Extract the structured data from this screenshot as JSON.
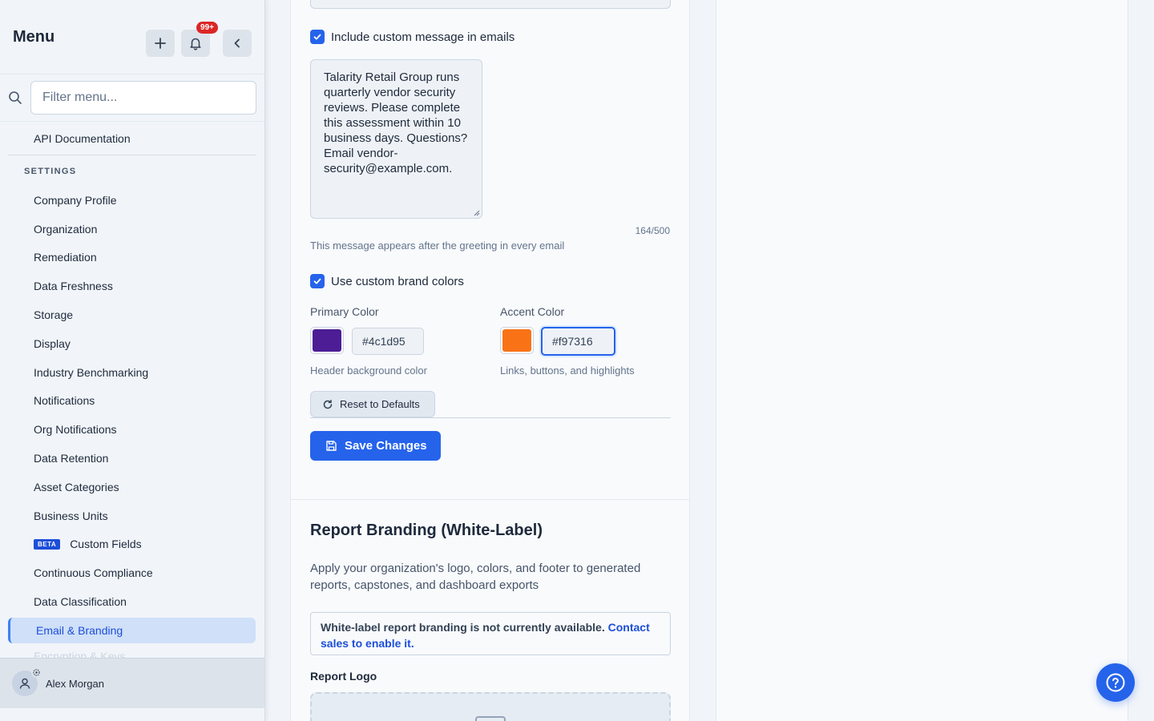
{
  "sidebar": {
    "title": "Menu",
    "notification_badge": "99+",
    "filter_placeholder": "Filter menu...",
    "api_item": "API Documentation",
    "section_label": "SETTINGS",
    "items": [
      {
        "label": "Company Profile"
      },
      {
        "label": "Organization"
      },
      {
        "label": "Remediation"
      },
      {
        "label": "Data Freshness"
      },
      {
        "label": "Storage"
      },
      {
        "label": "Display"
      },
      {
        "label": "Industry Benchmarking"
      },
      {
        "label": "Notifications"
      },
      {
        "label": "Org Notifications"
      },
      {
        "label": "Data Retention"
      },
      {
        "label": "Asset Categories"
      },
      {
        "label": "Business Units"
      },
      {
        "label": "Custom Fields",
        "tag": "BETA"
      },
      {
        "label": "Continuous Compliance"
      },
      {
        "label": "Data Classification"
      },
      {
        "label": "Email & Branding",
        "active": true
      },
      {
        "label": "Encryption & Keys"
      }
    ],
    "user_name": "Alex Morgan"
  },
  "email_settings": {
    "custom_message_label": "Include custom message in emails",
    "custom_message_checked": true,
    "custom_message_text": "Talarity Retail Group runs quarterly vendor security reviews. Please complete this assessment within 10 business days. Questions? Email vendor-security@example.com.",
    "char_counter": "164/500",
    "custom_message_help": "This message appears after the greeting in every email",
    "brand_colors_label": "Use custom brand colors",
    "brand_colors_checked": true,
    "primary_color_label": "Primary Color",
    "primary_color_value": "#4c1d95",
    "primary_color_help": "Header background color",
    "accent_color_label": "Accent Color",
    "accent_color_value": "#f97316",
    "accent_color_help": "Links, buttons, and highlights",
    "reset_label": "Reset to Defaults",
    "save_label": "Save Changes"
  },
  "report_branding": {
    "title": "Report Branding (White-Label)",
    "description": "Apply your organization's logo, colors, and footer to generated reports, capstones, and dashboard exports",
    "notice_text": "White-label report branding is not currently available.",
    "notice_link": "Contact sales to enable it.",
    "logo_label": "Report Logo"
  },
  "colors": {
    "accent": "#2563eb",
    "primary_swatch": "#4c1d95",
    "accent_swatch": "#f97316"
  },
  "icons": [
    "plus-icon",
    "bell-icon",
    "chevron-left-icon",
    "search-icon",
    "user-icon",
    "gear-icon",
    "check-icon",
    "refresh-icon",
    "save-icon",
    "help-icon",
    "upload-icon"
  ]
}
